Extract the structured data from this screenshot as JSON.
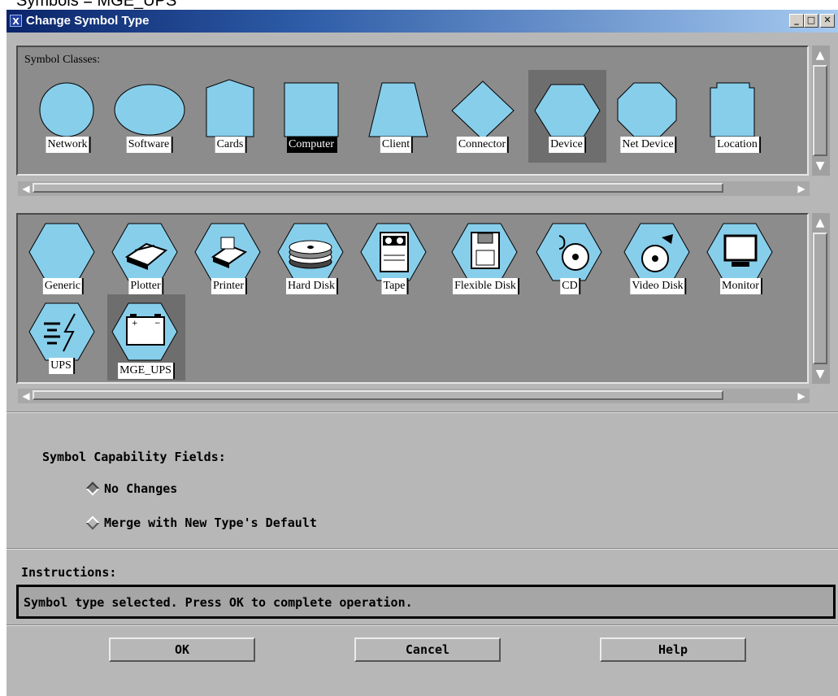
{
  "caption_partial": "Symbols = MGE_UPS",
  "window": {
    "title": "Change Symbol Type",
    "icon_glyph": "X",
    "controls": [
      "minimize-icon",
      "maximize-icon",
      "close-icon"
    ]
  },
  "symbol_classes": {
    "label": "Symbol Classes:",
    "selected": "Computer",
    "highlighted": "Device",
    "items": [
      {
        "label": "Network",
        "shape": "circle"
      },
      {
        "label": "Software",
        "shape": "ellipse"
      },
      {
        "label": "Cards",
        "shape": "pentagon"
      },
      {
        "label": "Computer",
        "shape": "square"
      },
      {
        "label": "Client",
        "shape": "trapezoid"
      },
      {
        "label": "Connector",
        "shape": "diamond"
      },
      {
        "label": "Device",
        "shape": "hexagon"
      },
      {
        "label": "Net Device",
        "shape": "octagon"
      },
      {
        "label": "Location",
        "shape": "notched-rect"
      }
    ]
  },
  "symbol_types": {
    "highlighted": "MGE_UPS",
    "items": [
      {
        "label": "Generic",
        "icon": "none"
      },
      {
        "label": "Plotter",
        "icon": "plotter-icon"
      },
      {
        "label": "Printer",
        "icon": "printer-icon"
      },
      {
        "label": "Hard Disk",
        "icon": "hard-disk-icon"
      },
      {
        "label": "Tape",
        "icon": "tape-icon"
      },
      {
        "label": "Flexible Disk",
        "icon": "floppy-disk-icon"
      },
      {
        "label": "CD",
        "icon": "cd-icon"
      },
      {
        "label": "Video Disk",
        "icon": "video-disk-icon"
      },
      {
        "label": "Monitor",
        "icon": "monitor-icon"
      },
      {
        "label": "UPS",
        "icon": "ups-icon"
      },
      {
        "label": "MGE_UPS",
        "icon": "battery-icon"
      }
    ]
  },
  "capability": {
    "title": "Symbol Capability Fields:",
    "options": [
      {
        "label": "No Changes",
        "selected": true
      },
      {
        "label": "Merge with New Type's Default",
        "selected": false
      }
    ]
  },
  "instructions": {
    "label": "Instructions:",
    "text": "Symbol type selected. Press OK to complete operation."
  },
  "buttons": {
    "ok": "OK",
    "cancel": "Cancel",
    "help": "Help"
  },
  "colors": {
    "shape_fill": "#87ceeb",
    "panel_bg": "#8c8c8c",
    "window_bg": "#b7b7b7",
    "selection_bg": "#6e6e6e",
    "title_bar": "#0a246a"
  }
}
